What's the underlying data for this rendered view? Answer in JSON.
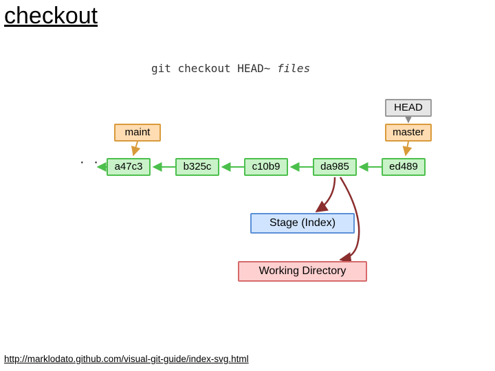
{
  "title": "checkout",
  "command": {
    "prefix": "git checkout HEAD~ ",
    "files": "files"
  },
  "head_label": "HEAD",
  "branches": {
    "maint": "maint",
    "master": "master"
  },
  "commits": [
    "a47c3",
    "b325c",
    "c10b9",
    "da985",
    "ed489"
  ],
  "ellipsis": "· · ·",
  "stage_label": "Stage (Index)",
  "wd_label": "Working Directory",
  "footer_url": "http://marklodato.github.com/visual-git-guide/index-svg.html",
  "colors": {
    "commit_fill": "#c9f2c9",
    "commit_border": "#4bbf4b",
    "branch_fill": "#ffdcb2",
    "branch_border": "#d99a3a",
    "head_fill": "#e6e6e6",
    "head_border": "#999999",
    "stage_fill": "#d0e4ff",
    "stage_border": "#5a8fd6",
    "wd_fill": "#ffd0d0",
    "wd_border": "#d66a6a"
  }
}
